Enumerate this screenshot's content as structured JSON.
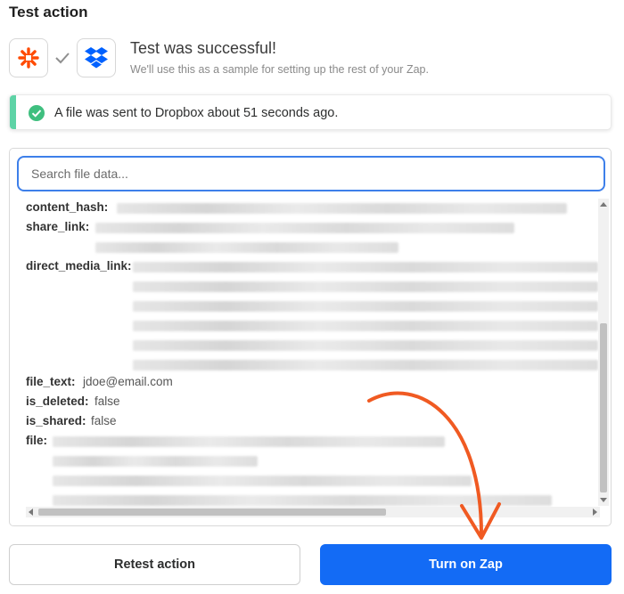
{
  "section": {
    "title": "Test action"
  },
  "apps": [
    {
      "name": "zapier",
      "icon": "zapier-icon",
      "color": "#ff4a00"
    },
    {
      "name": "dropbox",
      "icon": "dropbox-icon",
      "color": "#0061ff"
    }
  ],
  "test": {
    "title": "Test was successful!",
    "subtitle": "We'll use this as a sample for setting up the rest of your Zap."
  },
  "banner": {
    "message": "A file was sent to Dropbox about 51 seconds ago.",
    "accent_color": "#5ed3a6"
  },
  "search": {
    "placeholder": "Search file data...",
    "value": ""
  },
  "fields": {
    "content_hash": {
      "label": "content_hash:"
    },
    "share_link": {
      "label": "share_link:"
    },
    "direct_media_link": {
      "label": "direct_media_link:"
    },
    "file_text": {
      "label": "file_text:",
      "value": "jdoe@email.com"
    },
    "is_deleted": {
      "label": "is_deleted:",
      "value": "false"
    },
    "is_shared": {
      "label": "is_shared:",
      "value": "false"
    },
    "file": {
      "label": "file:"
    }
  },
  "buttons": {
    "retest": "Retest action",
    "turn_on": "Turn on Zap",
    "primary_color": "#136bf5"
  },
  "annotation": {
    "arrow_color": "#f05a22"
  }
}
